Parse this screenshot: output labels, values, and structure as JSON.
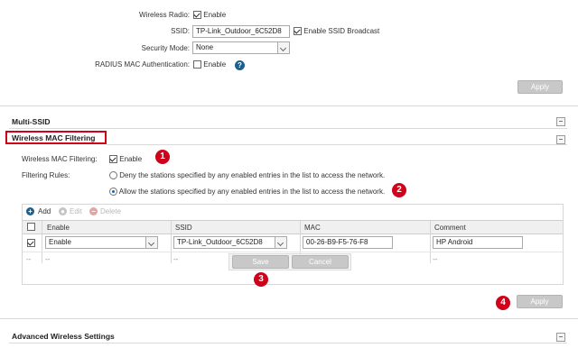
{
  "wireless": {
    "radio_label": "Wireless Radio:",
    "radio_value": "Enable",
    "ssid_label": "SSID:",
    "ssid_value": "TP-Link_Outdoor_6C52D8",
    "broadcast_label": "Enable SSID Broadcast",
    "security_label": "Security Mode:",
    "security_value": "None",
    "radius_label": "RADIUS MAC Authentication:",
    "radius_value": "Enable",
    "help_glyph": "?",
    "apply_label": "Apply"
  },
  "sections": {
    "multi_ssid": "Multi-SSID",
    "mac_filtering": "Wireless MAC Filtering",
    "advanced": "Advanced Wireless Settings"
  },
  "mac": {
    "filtering_label": "Wireless MAC Filtering:",
    "filtering_value": "Enable",
    "rules_label": "Filtering Rules:",
    "rule_deny": "Deny the stations specified by any enabled entries in the list to access the network.",
    "rule_allow": "Allow the stations specified by any enabled entries in the list to access the network.",
    "apply_label": "Apply"
  },
  "toolbar": {
    "add": "Add",
    "edit": "Edit",
    "delete": "Delete"
  },
  "table": {
    "headers": [
      "Enable",
      "SSID",
      "MAC",
      "Comment"
    ],
    "edit_row": {
      "enable": "Enable",
      "ssid": "TP-Link_Outdoor_6C52D8",
      "mac": "00-26-B9-F5-76-F8",
      "comment": "HP Android"
    },
    "empty_row": [
      "--",
      "--",
      "--",
      "--",
      "--"
    ],
    "save": "Save",
    "cancel": "Cancel"
  },
  "badges": [
    "1",
    "2",
    "3",
    "4"
  ],
  "colors": {
    "badge": "#d0021b",
    "highlight_border": "#d0021b",
    "button": "#c8c8c8",
    "add_icon": "#1e5f8e"
  }
}
